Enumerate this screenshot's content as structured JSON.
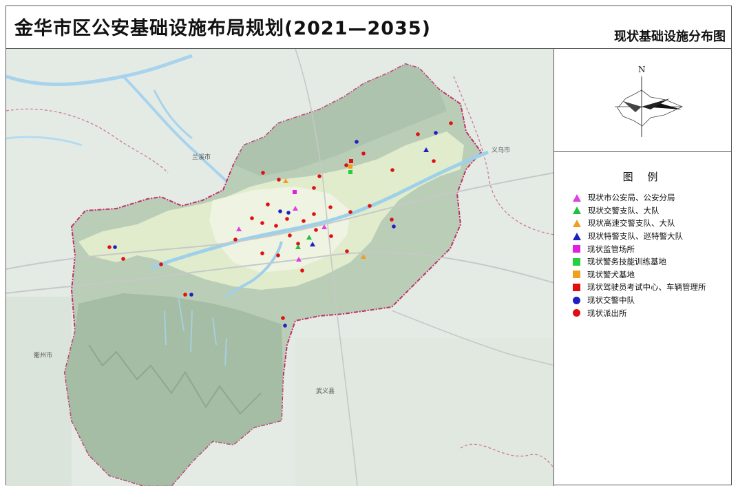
{
  "header": {
    "title": "金华市区公安基础设施布局规划(2021—2035)",
    "subtitle": "现状基础设施分布图"
  },
  "compass": {
    "north_label": "N"
  },
  "legend": {
    "title": "图 例",
    "items": [
      {
        "shape": "triangle",
        "color": "#e040e0",
        "label": "现状市公安局、公安分局"
      },
      {
        "shape": "triangle",
        "color": "#22c040",
        "label": "现状交警支队、大队"
      },
      {
        "shape": "triangle",
        "color": "#f0a020",
        "label": "现状高速交警支队、大队"
      },
      {
        "shape": "triangle",
        "color": "#2020c0",
        "label": "现状特警支队、巡特警大队"
      },
      {
        "shape": "square",
        "color": "#e020e0",
        "label": "现状监管场所"
      },
      {
        "shape": "square",
        "color": "#22d040",
        "label": "现状警务技能训练基地"
      },
      {
        "shape": "square",
        "color": "#f0a020",
        "label": "现状警犬基地"
      },
      {
        "shape": "square",
        "color": "#e01010",
        "label": "现状驾驶员考试中心、车辆管理所"
      },
      {
        "shape": "circle",
        "color": "#2020c0",
        "label": "现状交警中队"
      },
      {
        "shape": "circle",
        "color": "#e01010",
        "label": "现状派出所"
      }
    ]
  },
  "map": {
    "place_labels": {
      "lanxi": "兰溪市",
      "yiwu": "义乌市",
      "quzhou": "衢州市",
      "wuyi": "武义县"
    },
    "colors": {
      "background": "#e4ebe5",
      "district_fill": "#b9cdb7",
      "urban_fill": "#e6efcf",
      "boundary": "#c2306a",
      "water": "#9fd0ea"
    }
  }
}
